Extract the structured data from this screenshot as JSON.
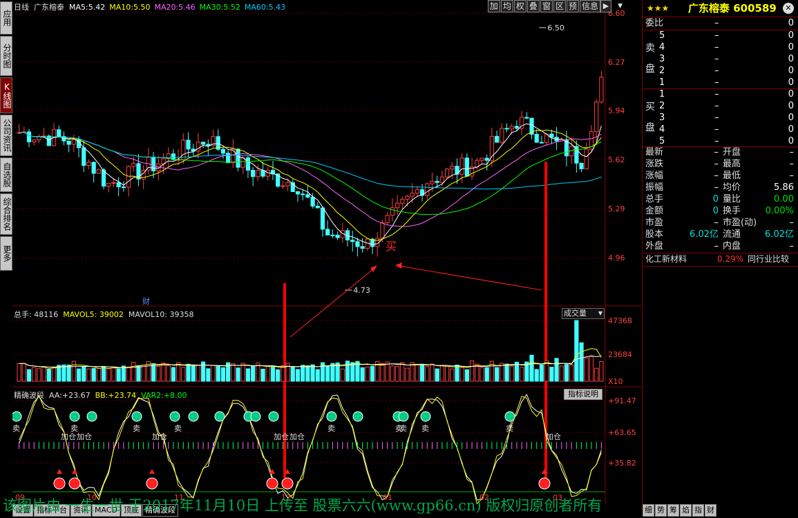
{
  "left_tabs": [
    "应用",
    "分时图",
    "K线图",
    "公司资讯",
    "自选股",
    "综合排名",
    "更多"
  ],
  "active_left_tab": 2,
  "main": {
    "period": "日线",
    "name": "广东榕泰",
    "ma": [
      {
        "label": "MA5:",
        "value": "5.42",
        "color": "#ffffff"
      },
      {
        "label": "MA10:",
        "value": "5.50",
        "color": "#ffff00"
      },
      {
        "label": "MA20:",
        "value": "5.46",
        "color": "#ff66ff"
      },
      {
        "label": "MA30:",
        "value": "5.52",
        "color": "#00ff00"
      },
      {
        "label": "MA60:",
        "value": "5.43",
        "color": "#00ccff"
      }
    ],
    "price_ticks": [
      "6.60",
      "6.27",
      "5.94",
      "5.62",
      "5.29",
      "4.96"
    ],
    "high_mark": "6.50",
    "low_mark": "4.73",
    "cai": "财",
    "buy_label": "买"
  },
  "toolbar": [
    "加",
    "均",
    "权",
    "叠",
    "窗",
    "区",
    "预",
    "信息"
  ],
  "volume": {
    "title": "总手:",
    "total": "48116",
    "mavol5_label": "MAVOL5:",
    "mavol5": "39002",
    "mavol10_label": "MAVOL10:",
    "mavol10": "39358",
    "dropdown": "成交量",
    "ticks": [
      "47368",
      "23684",
      "X10"
    ]
  },
  "indicator": {
    "name": "精确波段",
    "aa_label": "AA:",
    "aa": "+23.67",
    "bb_label": "BB:",
    "bb": "+23.74",
    "var2_label": "VAR2:",
    "var2": "+8.00",
    "help": "指标说明",
    "ticks": [
      "+91.47",
      "+63.65",
      "+35.82"
    ],
    "sell": "卖",
    "add": "加仓"
  },
  "months": [
    "09",
    "10",
    "11",
    "12",
    "01",
    "02",
    "03"
  ],
  "bottom_tabs": [
    "设置",
    "指标平台",
    "资讯",
    "MACD",
    "顶底",
    "精确波段"
  ],
  "active_bottom_tab": 5,
  "watermark": "该图片由 一生一世 于2017年11月10日 上传至 股票六六(www.gp66.cn) 版权归原创者所有",
  "right": {
    "stars": "★★★",
    "title": "广东榕泰 600589",
    "weibi_label": "委比",
    "weibi": "–",
    "weibi_right": "0",
    "sell_side": "卖盘",
    "buy_side": "买盘",
    "sell_rows": [
      {
        "n": "5",
        "p": "–",
        "v": "0"
      },
      {
        "n": "4",
        "p": "–",
        "v": "0"
      },
      {
        "n": "3",
        "p": "–",
        "v": "0"
      },
      {
        "n": "2",
        "p": "–",
        "v": "0"
      },
      {
        "n": "1",
        "p": "–",
        "v": "0"
      }
    ],
    "buy_rows": [
      {
        "n": "1",
        "p": "–",
        "v": "0"
      },
      {
        "n": "2",
        "p": "–",
        "v": "0"
      },
      {
        "n": "3",
        "p": "–",
        "v": "0"
      },
      {
        "n": "4",
        "p": "–",
        "v": "0"
      },
      {
        "n": "5",
        "p": "–",
        "v": "0"
      }
    ],
    "stats": [
      {
        "l1": "最新",
        "v1": "–",
        "l2": "开盘",
        "v2": "–"
      },
      {
        "l1": "涨跌",
        "v1": "–",
        "l2": "最高",
        "v2": "–"
      },
      {
        "l1": "涨幅",
        "v1": "–",
        "l2": "最低",
        "v2": "–"
      },
      {
        "l1": "振幅",
        "v1": "–",
        "l2": "均价",
        "v2": "5.86"
      },
      {
        "l1": "总手",
        "v1": "0",
        "l2": "量比",
        "v2": "0.00"
      },
      {
        "l1": "金额",
        "v1": "0",
        "l2": "换手",
        "v2": "0.00%"
      },
      {
        "l1": "市盈",
        "v1": "–",
        "l2": "市盈(动)",
        "v2": "–"
      },
      {
        "l1": "股本",
        "v1": "6.02亿",
        "l2": "流通",
        "v2": "6.02亿"
      },
      {
        "l1": "外盘",
        "v1": "–",
        "l2": "内盘",
        "v2": "–"
      }
    ],
    "industry": "化工新材料",
    "industry_pct": "0.29%",
    "compare": "同行业比较",
    "rb_tabs": [
      "细",
      "势",
      "筹",
      "焰",
      "指",
      "财"
    ]
  }
}
